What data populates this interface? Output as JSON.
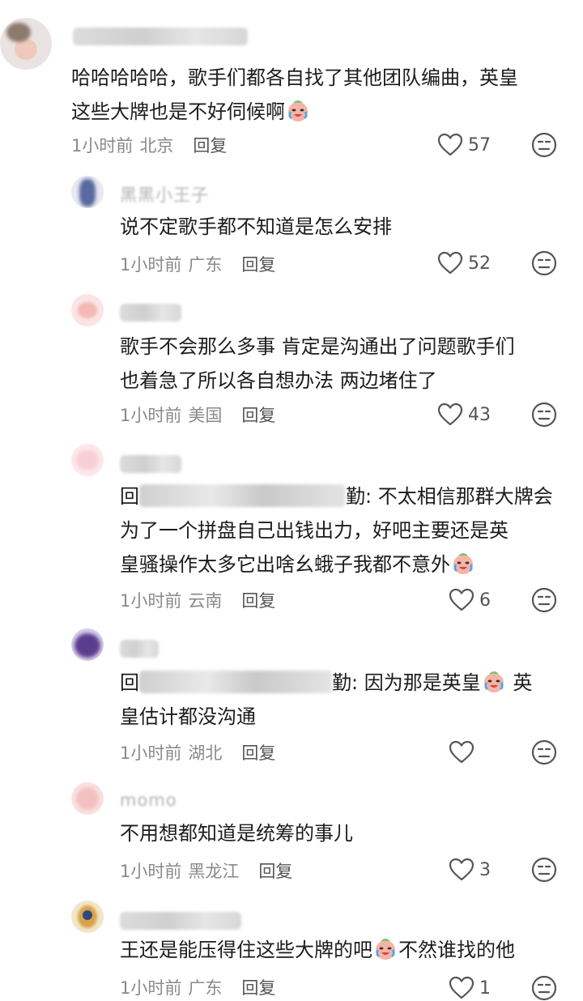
{
  "comments": [
    {
      "nickname": "",
      "body_line1": "哈哈哈哈哈，歌手们都各自找了其他团队编曲，英皇",
      "body_line2": "这些大牌也是不好伺候啊",
      "time": "1小时前",
      "location": "北京",
      "reply_label": "回复",
      "like_count": "57"
    },
    {
      "nickname": "黑黑小王子",
      "body_line1": "说不定歌手都不知道是怎么安排",
      "time": "1小时前",
      "location": "广东",
      "reply_label": "回复",
      "like_count": "52"
    },
    {
      "nickname": "",
      "body_line1": "歌手不会那么多事 肯定是沟通出了问题歌手们",
      "body_line2": "也着急了所以各自想办法 两边堵住了",
      "time": "1小时前",
      "location": "美国",
      "reply_label": "回复",
      "like_count": "43"
    },
    {
      "nickname": "",
      "reply_prefix": "回",
      "reply_target_suffix": "勤: 不太相信那群大牌会",
      "body_line2": "为了一个拼盘自己出钱出力，好吧主要还是英",
      "body_line3": "皇骚操作太多它出啥幺蛾子我都不意外",
      "time": "1小时前",
      "location": "云南",
      "reply_label": "回复",
      "like_count": "6"
    },
    {
      "nickname": "",
      "reply_prefix": "回",
      "reply_target_suffix": "勤: 因为那是英皇",
      "body_line1_after": " 英",
      "body_line2": "皇估计都没沟通",
      "time": "1小时前",
      "location": "湖北",
      "reply_label": "回复",
      "like_count": ""
    },
    {
      "nickname": "momo",
      "body_line1": "不用想都知道是统筹的事儿",
      "time": "1小时前",
      "location": "黑龙江",
      "reply_label": "回复",
      "like_count": "3"
    },
    {
      "nickname": "",
      "body_line1_pre": "王还是能压得住这些大牌的吧",
      "body_line1_post": "不然谁找的他",
      "time": "1小时前",
      "location": "广东",
      "reply_label": "回复",
      "like_count": "1"
    }
  ],
  "icons": {
    "like": "heart-outline-icon",
    "dislike": "unhappy-face-icon",
    "emoji": "crying-laughing-emoji"
  },
  "colors": {
    "text": "#1c1c1c",
    "meta": "#8a8a8a",
    "icon": "#555555"
  }
}
